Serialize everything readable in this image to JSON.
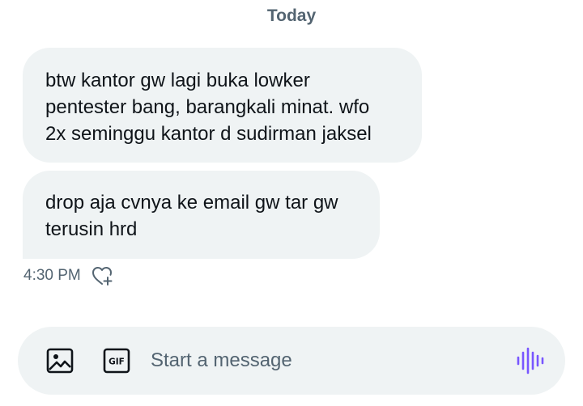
{
  "conversation": {
    "date_divider": "Today",
    "messages": [
      {
        "lines": [
          "btw kantor gw lagi buka lowker",
          "pentester bang, barangkali minat. wfo",
          "2x seminggu kantor d sudirman jaksel"
        ]
      },
      {
        "lines": [
          "drop aja cvnya ke email gw tar gw",
          "terusin hrd"
        ]
      }
    ],
    "timestamp": "4:30 PM"
  },
  "composer": {
    "placeholder": "Start a message",
    "icons": {
      "image": "image-icon",
      "gif": "gif-icon",
      "voice": "voice-waveform-icon",
      "reaction": "heart-add-icon"
    },
    "gif_label": "GIF"
  },
  "colors": {
    "bubble_background": "#eff3f4",
    "text_primary": "#0f1419",
    "text_secondary": "#536471",
    "voice_accent": "#7856ff"
  }
}
